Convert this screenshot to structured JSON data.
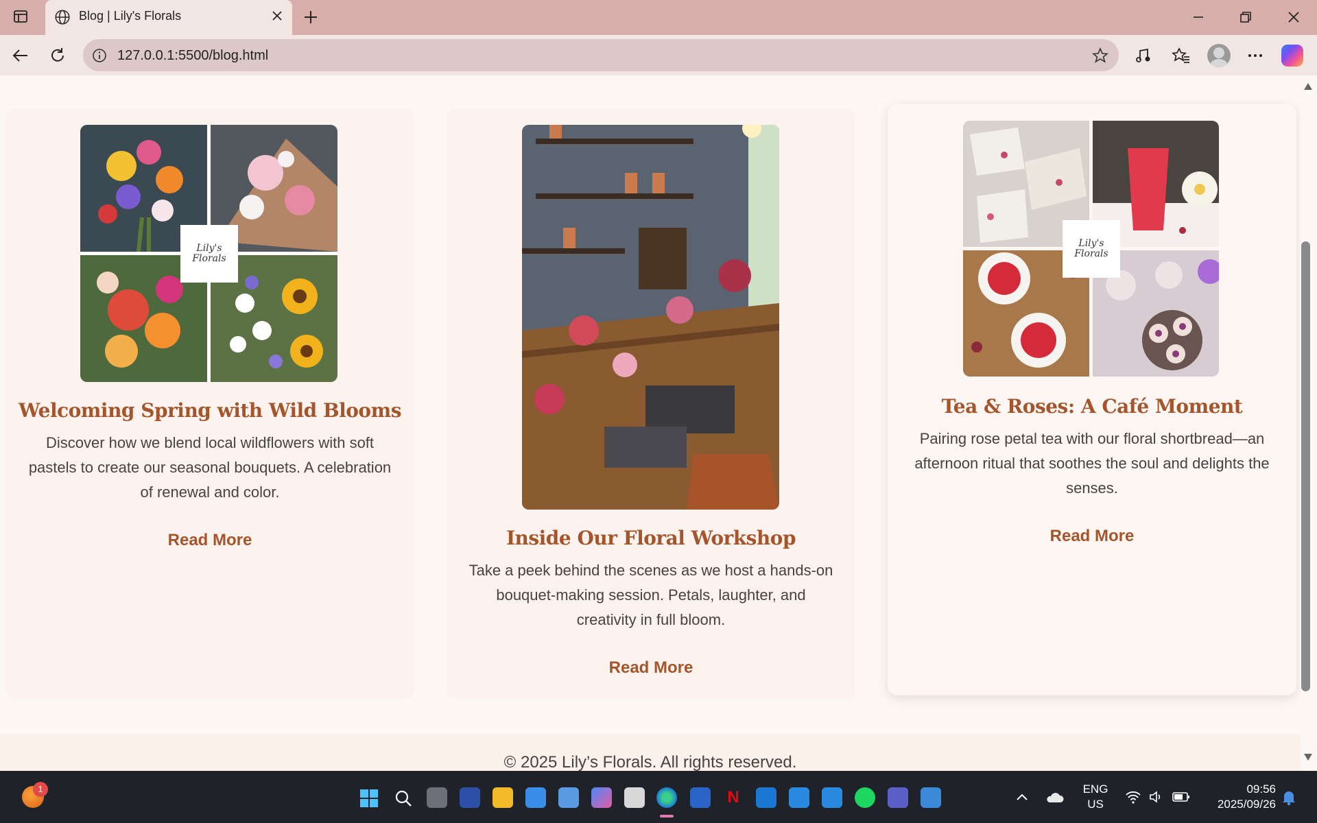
{
  "browser": {
    "tab_title": "Blog | Lily's Florals",
    "url": "127.0.0.1:5500/blog.html"
  },
  "posts": [
    {
      "title": "Welcoming Spring with Wild Blooms",
      "excerpt_lines": [
        "Discover how we blend local wildflowers with soft",
        "pastels to create our seasonal bouquets. A celebration",
        "of renewal and color."
      ],
      "link": "Read More",
      "logo": "Lily's Florals"
    },
    {
      "title": "Inside Our Floral Workshop",
      "excerpt_lines": [
        "Take a peek behind the scenes as we host a hands-on",
        "bouquet-making session. Petals, laughter, and",
        "creativity in full bloom."
      ],
      "link": "Read More"
    },
    {
      "title": "Tea & Roses: A Café Moment",
      "excerpt_lines": [
        "Pairing rose petal tea with our floral shortbread—an",
        "afternoon ritual that soothes the soul and delights the",
        "senses."
      ],
      "link": "Read More",
      "logo": "Lily's Florals"
    }
  ],
  "footer": "© 2025 Lily’s Florals. All rights reserved.",
  "taskbar": {
    "notification_count": "1",
    "lang_line1": "ENG",
    "lang_line2": "US",
    "time": "09:56",
    "date": "2025/09/26"
  },
  "colors": {
    "accent": "#a4552c",
    "titlebar": "#d8aeaa",
    "page_bg": "#fdf8f4"
  }
}
